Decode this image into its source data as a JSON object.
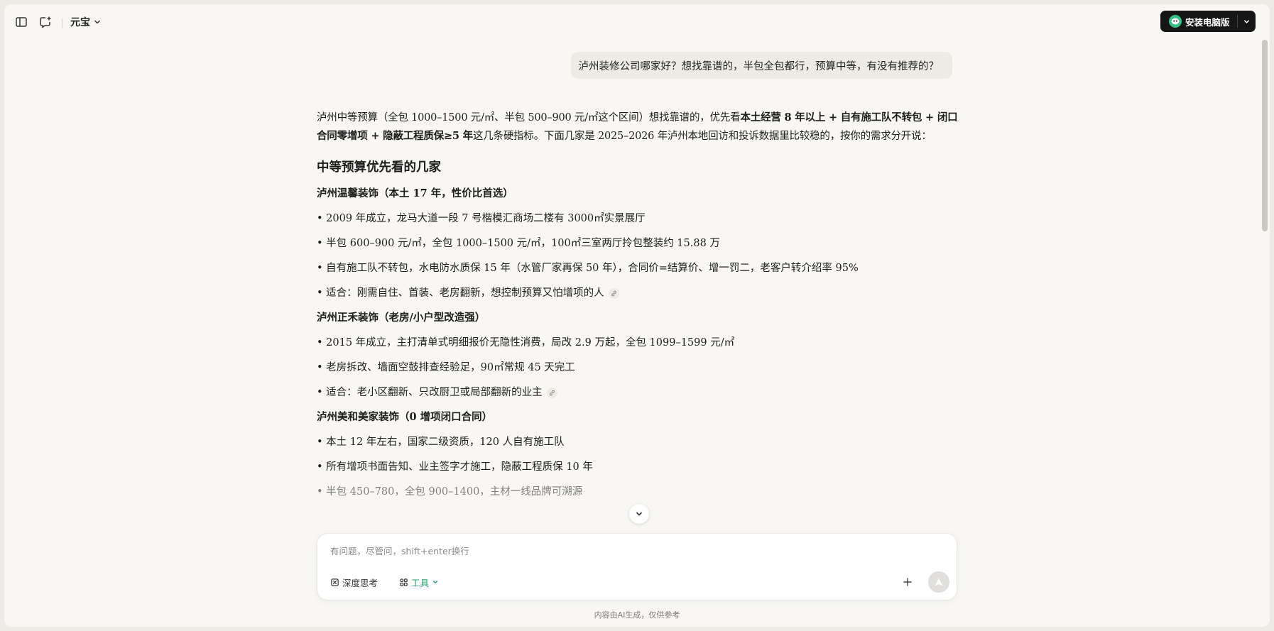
{
  "topbar": {
    "model_name": "元宝",
    "install_label": "安装电脑版"
  },
  "conversation": {
    "user_message": "泸州装修公司哪家好？想找靠谱的，半包全包都行，预算中等，有没有推荐的？",
    "answer": {
      "intro_p1": "泸州中等预算（全包 1000–1500 元/㎡、半包 500–900 元/㎡这个区间）想找靠谱的，优先看",
      "intro_bold1": "本土经营 8 年以上 + 自有施工队不转包 + 闭口合同零增项 + 隐蔽工程质保≥5 年",
      "intro_p2": "这几条硬指标。下面几家是 2025–2026 年泸州本地回访和投诉数据里比较稳的，按你的需求分开说：",
      "heading": "中等预算优先看的几家",
      "companies": [
        {
          "title": "泸州温馨装饰（本土 17 年，性价比首选）",
          "items": [
            "• 2009 年成立，龙马大道一段 7 号楷模汇商场二楼有 3000㎡实景展厅",
            "• 半包 600–900 元/㎡，全包 1000–1500 元/㎡，100㎡三室两厅拎包整装约 15.88 万",
            "• 自有施工队不转包，水电防水质保 15 年（水管厂家再保 50 年），合同价=结算价、增一罚二，老客户转介绍率 95%",
            "• 适合：刚需自住、首装、老房翻新，想控制预算又怕增项的人"
          ]
        },
        {
          "title": "泸州正禾装饰（老房/小户型改造强）",
          "items": [
            "• 2015 年成立，主打清单式明细报价无隐性消费，局改 2.9 万起，全包 1099–1599 元/㎡",
            "• 老房拆改、墙面空鼓排查经验足，90㎡常规 45 天完工",
            "• 适合：老小区翻新、只改厨卫或局部翻新的业主"
          ]
        },
        {
          "title": "泸州美和美家装饰（0 增项闭口合同）",
          "items": [
            "• 本土 12 年左右，国家二级资质，120 人自有施工队",
            "• 所有增项书面告知、业主签字才施工，隐蔽工程质保 10 年",
            "• 半包 450–780，全包 900–1400，主材一线品牌可溯源"
          ]
        }
      ]
    }
  },
  "composer": {
    "placeholder": "有问题，尽管问，shift+enter换行",
    "deep_think_label": "深度思考",
    "tools_label": "工具"
  },
  "footer": {
    "disclaimer": "内容由AI生成，仅供参考"
  },
  "colors": {
    "accent_green": "#2aa26a",
    "install_bg": "#161616",
    "page_bg": "#f8f7f3"
  }
}
